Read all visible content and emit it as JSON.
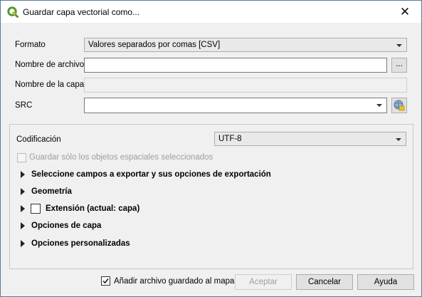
{
  "window": {
    "title": "Guardar capa vectorial como...",
    "close_label": "✕"
  },
  "form": {
    "format": {
      "label": "Formato",
      "value": "Valores separados por comas [CSV]"
    },
    "filename": {
      "label": "Nombre de archivo",
      "value": "",
      "browse_label": "..."
    },
    "layer_name": {
      "label": "Nombre de la capa",
      "value": ""
    },
    "crs": {
      "label": "SRC",
      "value": ""
    }
  },
  "options": {
    "encoding": {
      "label": "Codificación",
      "value": "UTF-8"
    },
    "selected_only_label": "Guardar sólo los objetos espaciales seleccionados",
    "sections": {
      "fields": "Seleccione campos a exportar y sus opciones de exportación",
      "geometry": "Geometría",
      "extent": "Extensión (actual: capa)",
      "layer_options": "Opciones de capa",
      "custom_options": "Opciones personalizadas"
    }
  },
  "footer": {
    "add_to_map_label": "Añadir archivo guardado al mapa",
    "add_to_map_checked": true,
    "accept_label": "Aceptar",
    "cancel_label": "Cancelar",
    "help_label": "Ayuda"
  },
  "colors": {
    "qgis_green": "#589632",
    "qgis_yellow": "#f0c22b",
    "disabled_text": "#9e9e9e"
  }
}
